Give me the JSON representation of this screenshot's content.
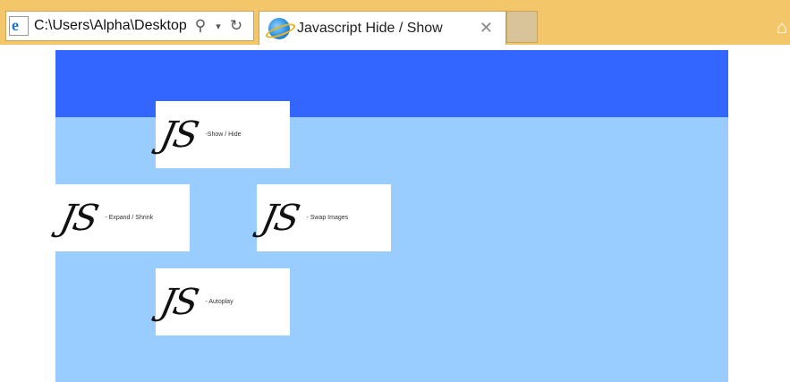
{
  "browser": {
    "address": "C:\\Users\\Alpha\\Desktop",
    "search_icon": "search-icon",
    "dropdown_icon": "chevron-down-icon",
    "refresh_icon": "refresh-icon",
    "tab_title": "Javascript Hide / Show",
    "close_glyph": "✕",
    "home_icon": "home-icon"
  },
  "colors": {
    "chrome": "#f3c66a",
    "header": "#3366ff",
    "page": "#99ccff"
  },
  "tiles": [
    {
      "logo": "JS",
      "caption": "-Show / Hide"
    },
    {
      "logo": "JS",
      "caption": "- Expand / Shrink"
    },
    {
      "logo": "JS",
      "caption": "- Swap Images"
    },
    {
      "logo": "JS",
      "caption": "- Autoplay"
    }
  ]
}
